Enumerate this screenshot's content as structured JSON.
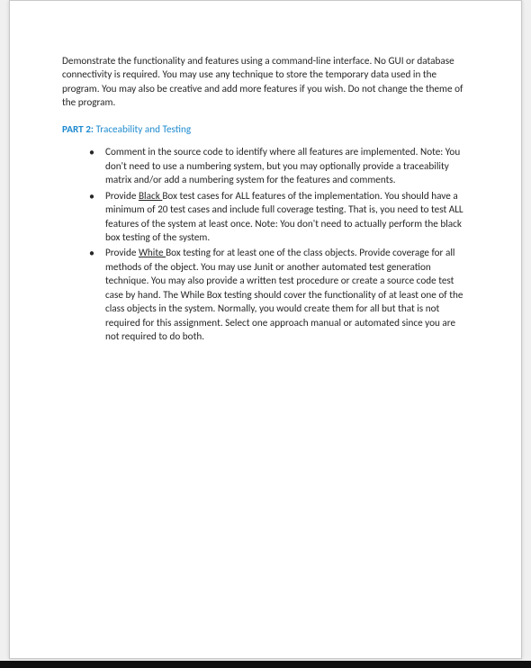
{
  "intro": "Demonstrate the functionality and features using a command-line interface. No GUI or database connectivity is required. You may use any technique to store the temporary data used in the program. You may also be creative and add more features if you wish. Do not change the theme of the program.",
  "part": {
    "label": "PART 2:",
    "title": "Traceability and Testing"
  },
  "bullets": {
    "b1": "Comment in the source code to identify where all features are implemented. Note: You don't need to use a numbering system, but you may optionally provide a traceability matrix and/or add a numbering system for the features and comments.",
    "b2_pre": "Provide ",
    "b2_u": "Black ",
    "b2_post": "Box test cases for ALL features of the implementation. You should have a minimum of 20 test cases and include full coverage testing. That is, you need to test ALL features of the system at least once. Note: You don't need to actually perform the black box testing of the system.",
    "b3_pre": "Provide ",
    "b3_u": "White ",
    "b3_post": "Box testing for at least one of the class objects. Provide coverage for all methods of the object. You may use Junit or another automated test generation technique. You may also provide a written test procedure or create a source code test case by hand. The While Box testing should cover the functionality of at least one of the class objects in the system. Normally, you would create them for all but that is not required for this assignment. Select one approach manual or automated since you are not required to do both."
  }
}
